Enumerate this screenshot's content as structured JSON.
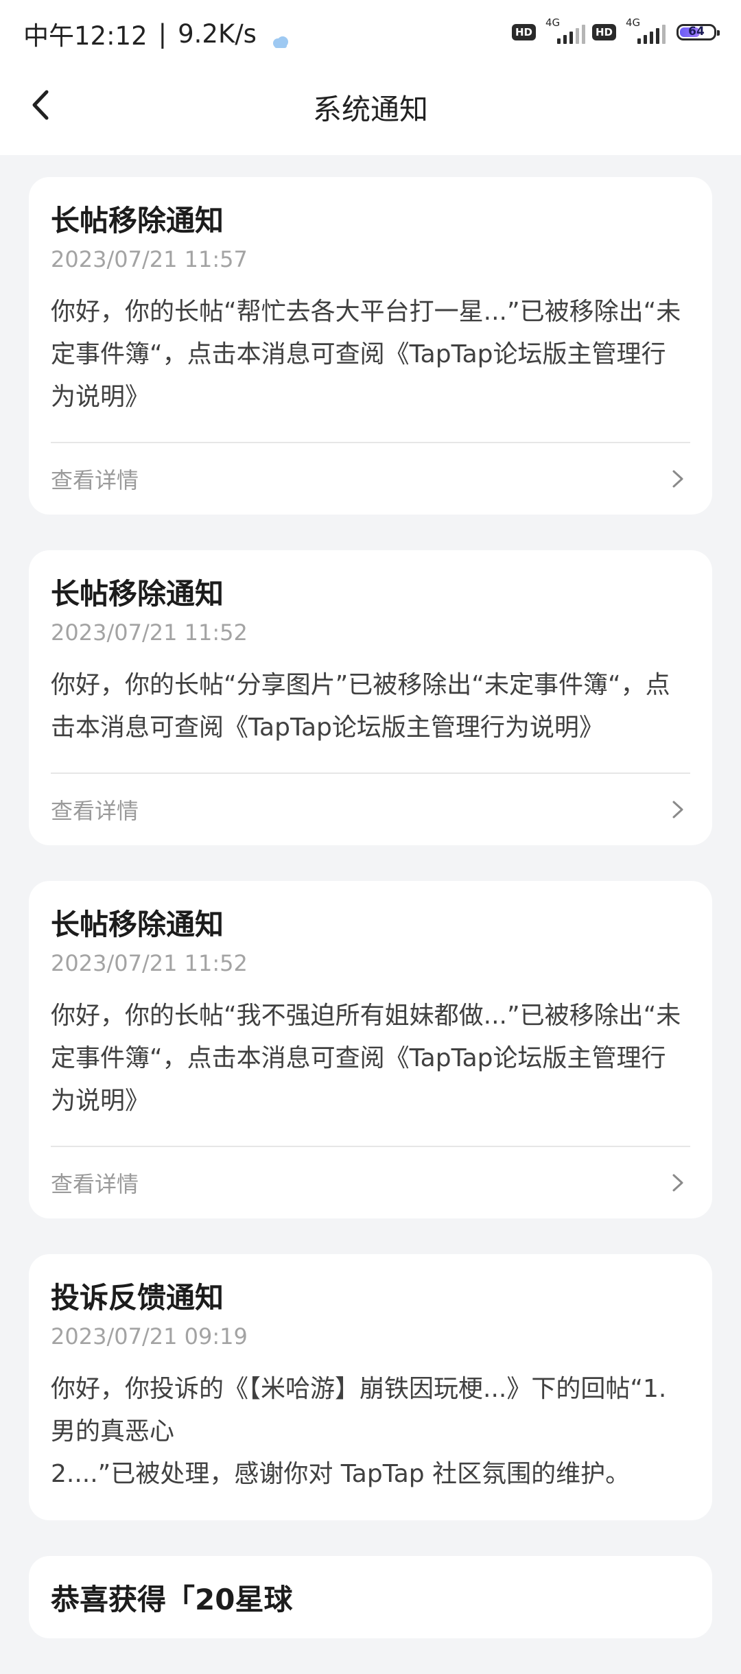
{
  "status_bar": {
    "time": "中午12:12",
    "speed": "9.2K/s",
    "hd1": "HD",
    "net1": "4G",
    "hd2": "HD",
    "net2": "4G",
    "battery": "64",
    "battery_level": 0.64
  },
  "nav": {
    "title": "系统通知"
  },
  "footer_label": "查看详情",
  "notifications": [
    {
      "title": "长帖移除通知",
      "time": "2023/07/21 11:57",
      "body": "你好，你的长帖“帮忙去各大平台打一星...”已被移除出“未定事件簿“，点击本消息可查阅《TapTap论坛版主管理行为说明》"
    },
    {
      "title": "长帖移除通知",
      "time": "2023/07/21 11:52",
      "body": "你好，你的长帖“分享图片”已被移除出“未定事件簿“，点击本消息可查阅《TapTap论坛版主管理行为说明》"
    },
    {
      "title": "长帖移除通知",
      "time": "2023/07/21 11:52",
      "body": "你好，你的长帖“我不强迫所有姐妹都做...”已被移除出“未定事件簿“，点击本消息可查阅《TapTap论坛版主管理行为说明》"
    },
    {
      "title": "投诉反馈通知",
      "time": "2023/07/21 09:19",
      "body": "你好，你投诉的《【米哈游】崩铁因玩梗...》下的回帖“1.男的真恶心\n2....”已被处理，感谢你对 TapTap 社区氛围的维护。"
    },
    {
      "title": "恭喜获得「20星球"
    }
  ]
}
